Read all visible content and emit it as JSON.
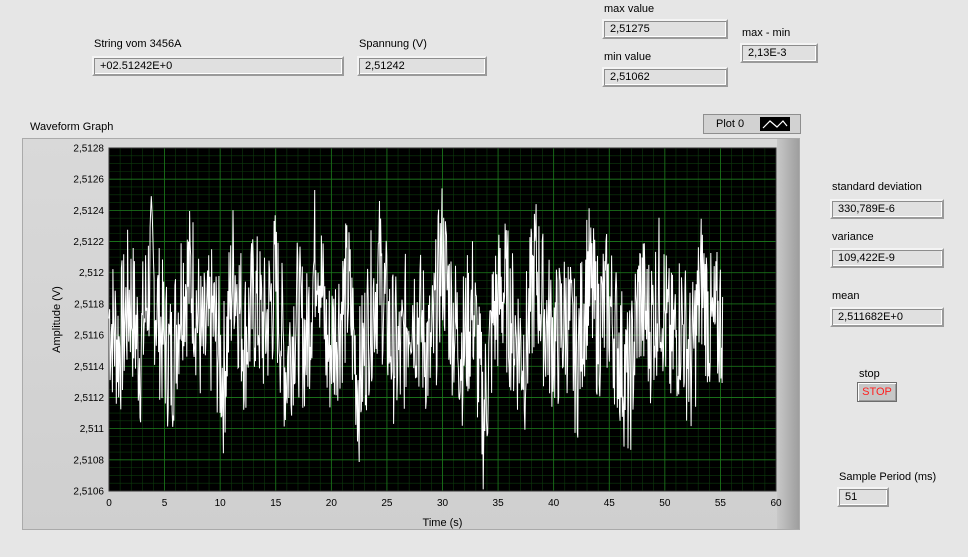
{
  "indicators": {
    "string": {
      "label": "String vom 3456A",
      "value": "+02.51242E+0"
    },
    "voltage": {
      "label": "Spannung (V)",
      "value": "2,51242"
    },
    "max": {
      "label": "max value",
      "value": "2,51275"
    },
    "min": {
      "label": "min value",
      "value": "2,51062"
    },
    "range": {
      "label": "max - min",
      "value": "2,13E-3"
    },
    "stddev": {
      "label": "standard deviation",
      "value": "330,789E-6"
    },
    "variance": {
      "label": "variance",
      "value": "109,422E-9"
    },
    "mean": {
      "label": "mean",
      "value": "2,511682E+0"
    },
    "sample_period": {
      "label": "Sample Period (ms)",
      "value": "51"
    }
  },
  "stop": {
    "label": "stop",
    "button": "STOP",
    "color": "#ff1f1f"
  },
  "graph": {
    "title": "Waveform Graph",
    "legend": "Plot 0"
  },
  "chart_data": {
    "type": "line",
    "title": "Waveform Graph",
    "xlabel": "Time (s)",
    "ylabel": "Amplitude (V)",
    "xlim": [
      0,
      60
    ],
    "ylim": [
      2.5106,
      2.5128
    ],
    "x_ticks": [
      "0",
      "5",
      "10",
      "15",
      "20",
      "25",
      "30",
      "35",
      "40",
      "45",
      "50",
      "55",
      "60"
    ],
    "y_ticks": [
      "2,5106",
      "2,5108",
      "2,511",
      "2,5112",
      "2,5114",
      "2,5116",
      "2,5118",
      "2,512",
      "2,5122",
      "2,5124",
      "2,5126",
      "2,5128"
    ],
    "grid": true,
    "background": "#000000",
    "grid_color": "#1c7a1c",
    "series": [
      {
        "name": "Plot 0",
        "color": "#ffffff",
        "sample_interval_s": 0.051,
        "x_start": 0,
        "x_end": 55.2,
        "values": [
          2.51172,
          2.51151,
          2.51188,
          2.51145,
          2.51209,
          2.51162,
          2.51138,
          2.51196,
          2.51201,
          2.51148,
          2.51171,
          2.51128,
          2.51211,
          2.51155,
          2.51183,
          2.51162,
          2.51198,
          2.51134,
          2.51176,
          2.51152,
          2.51231,
          2.51146,
          2.51168,
          2.51193,
          2.51121,
          2.51172,
          2.51205,
          2.51158,
          2.51139,
          2.51186,
          2.51165,
          2.51142,
          2.51218,
          2.51171,
          2.51149,
          2.51181,
          2.51098,
          2.51175,
          2.51192,
          2.51161,
          2.51144,
          2.51209,
          2.51168,
          2.51155,
          2.51173,
          2.51136,
          2.51202,
          2.51166,
          2.51183,
          2.51151,
          2.51119,
          2.51188,
          2.51163,
          2.51194,
          2.51148,
          2.51172,
          2.51137,
          2.51199,
          2.51158,
          2.51174
        ]
      }
    ]
  }
}
